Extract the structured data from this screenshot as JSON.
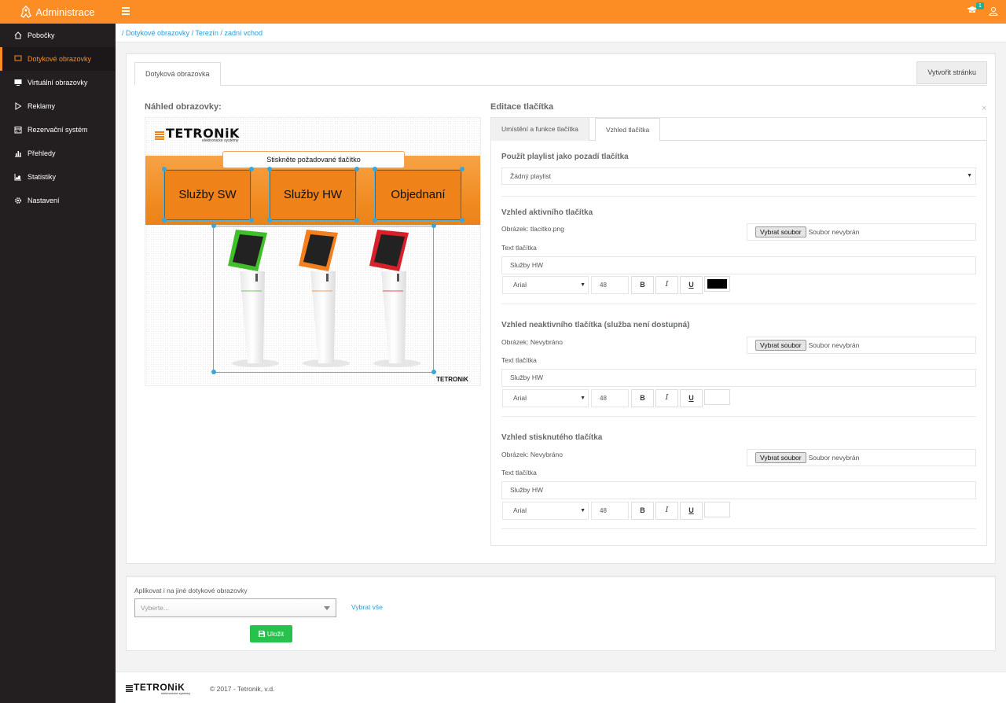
{
  "app": {
    "title": "Administrace",
    "notification_count": "1"
  },
  "sidebar": {
    "items": [
      {
        "label": "Pobočky",
        "icon": "home-icon"
      },
      {
        "label": "Dotykové obrazovky",
        "icon": "touch-screen-icon"
      },
      {
        "label": "Virtuální obrazovky",
        "icon": "monitor-icon"
      },
      {
        "label": "Reklamy",
        "icon": "play-icon"
      },
      {
        "label": "Rezervační systém",
        "icon": "calendar-icon"
      },
      {
        "label": "Přehledy",
        "icon": "bar-chart-icon"
      },
      {
        "label": "Statistiky",
        "icon": "area-chart-icon"
      },
      {
        "label": "Nastavení",
        "icon": "gear-icon"
      }
    ]
  },
  "breadcrumb": [
    "Dotykové obrazovky",
    "Terezín",
    "zadní vchod"
  ],
  "tabs": {
    "main": "Dotyková obrazovka",
    "create_page": "Vytvořit stránku"
  },
  "preview": {
    "title": "Náhled obrazovky:",
    "logo": "TETRONiK",
    "logo_sub": "elektronické systémy",
    "header_button": "Stiskněte požadované tlačítko",
    "buttons": [
      "Služby SW",
      "Služby HW",
      "Objednaní"
    ],
    "footer_logo": "TETRONiK"
  },
  "editor": {
    "title": "Editace tlačítka",
    "tabs": [
      "Umístění a funkce tlačítka",
      "Vzhled tlačítka"
    ],
    "playlist": {
      "title": "Použít playlist jako pozadí tlačítka",
      "value": "Žádný playlist"
    },
    "file_button": "Vybrat soubor",
    "file_none": "Soubor nevybrán",
    "text_label": "Text tlačítka",
    "sections": [
      {
        "title": "Vzhled aktivního tlačítka",
        "image": "Obrázek: tlacitko.png",
        "text": "Služby HW",
        "font": "Arial",
        "size": "48",
        "color": "#000000"
      },
      {
        "title": "Vzhled neaktivního tlačítka (služba není dostupná)",
        "image": "Obrázek: Nevybráno",
        "text": "Služby HW",
        "font": "Arial",
        "size": "48",
        "color": "#ffffff"
      },
      {
        "title": "Vzhled stisknutého tlačítka",
        "image": "Obrázek: Nevybráno",
        "text": "Služby HW",
        "font": "Arial",
        "size": "48",
        "color": "#ffffff"
      }
    ],
    "format": {
      "bold": "B",
      "italic": "I",
      "underline": "U"
    }
  },
  "apply": {
    "label": "Aplikovat i na jiné dotykové obrazovky",
    "placeholder": "Vyberte...",
    "select_all": "Vybrat vše",
    "save": "Uložit"
  },
  "footer": {
    "logo": "TETRONiK",
    "logo_sub": "elektronické systémy",
    "copyright": "© 2017 - Tetronik, v.d."
  },
  "colors": {
    "accent": "#fb8d24",
    "sidebar": "#231f20",
    "save": "#27c24c",
    "link": "#2b9bd4"
  }
}
